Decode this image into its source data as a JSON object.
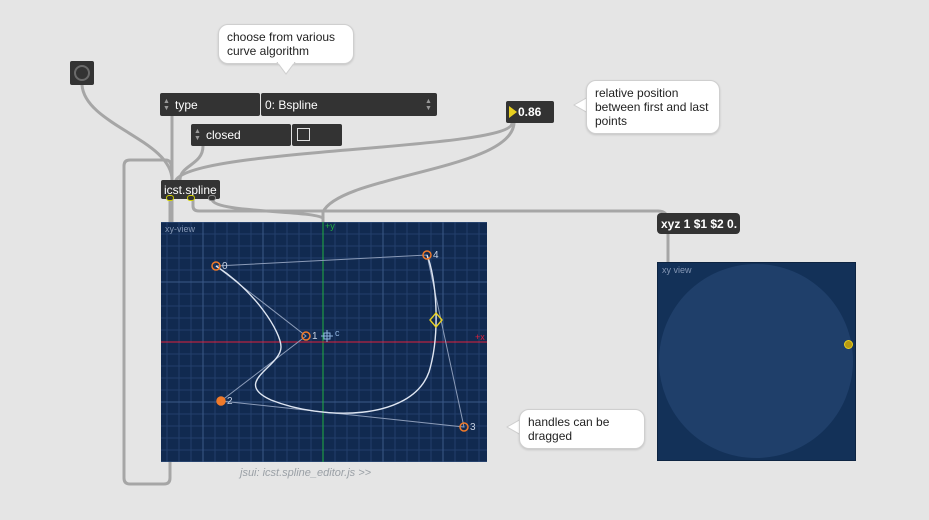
{
  "comments": {
    "curve_algorithm": "choose from various curve algorithm",
    "relative_position": "relative position between first and last points",
    "handles": "handles can be dragged"
  },
  "umenu_type": {
    "label": "type",
    "value": "0: Bspline"
  },
  "closed_toggle": {
    "label": "closed",
    "checked": false
  },
  "flonum": {
    "value": "0.86"
  },
  "spline_object": {
    "text": "icst.spline"
  },
  "message_box": {
    "text": "xyz 1 $1 $2 0."
  },
  "xy_view_left": {
    "title": "xy-view",
    "axis_y_label": "+y",
    "axis_x_label": "+x",
    "center_label": "c",
    "points": [
      {
        "label": "0"
      },
      {
        "label": "1"
      },
      {
        "label": "2"
      },
      {
        "label": "3"
      },
      {
        "label": "4"
      }
    ]
  },
  "xy_view_right": {
    "title": "xy view"
  },
  "jsui_caption": "jsui: icst.spline_editor.js >>",
  "colors": {
    "background": "#e5e5e5",
    "object_fill": "#333333",
    "panel_fill": "#112a50",
    "grid": "#2a4a7a",
    "x_axis": "#e0203c",
    "y_axis": "#21b040",
    "handle": "#f07a2a",
    "curve": "#dfe6f2",
    "slider_marker": "#e8d020"
  },
  "icons": {
    "button": "bang-circle-icon",
    "flonum_arrow": "triangle-right-icon"
  }
}
